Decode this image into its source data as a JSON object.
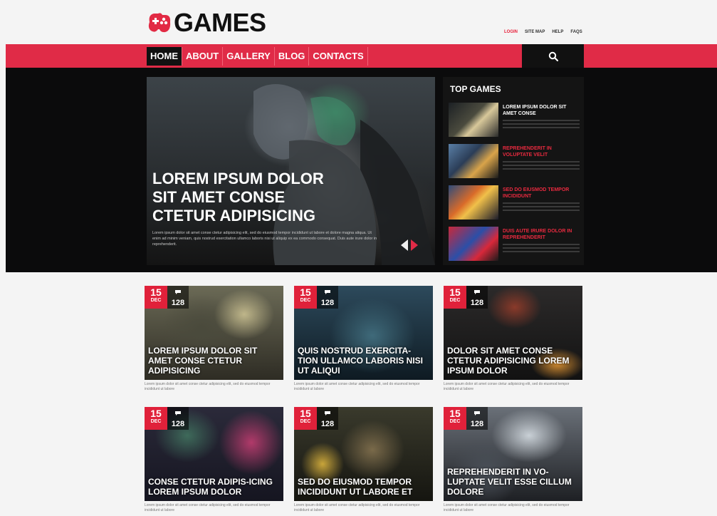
{
  "brand": {
    "name": "GAMES",
    "accent": "#e02b47"
  },
  "top_links": [
    "LOGIN",
    "SITE MAP",
    "HELP",
    "FAQS"
  ],
  "nav": {
    "items": [
      "HOME",
      "ABOUT",
      "GALLERY",
      "BLOG",
      "CONTACTS"
    ],
    "active": "HOME",
    "search_icon": "search-icon"
  },
  "hero": {
    "title": "LOREM IPSUM DOLOR SIT AMET CONSE CTETUR ADIPISICING",
    "text": "Lorem ipsum dolor sit amet conse ctetur adipisicing elit, sed do eiusmod tempor incididunt ut labore et dolore magna aliqua. Ut enim ad minim veniam, quis nostrud exercitation ullamco laboris nisi ut aliquip ex ea commodo consequat. Duis aute irure dolor in reprehenderit."
  },
  "top_games": {
    "heading": "TOP GAMES",
    "items": [
      {
        "title": "LOREM IPSUM DOLOR SIT AMET CONSE",
        "desc": "Lorem ipsum dolor sit amet conse ctetur adipisicing elit"
      },
      {
        "title": "REPREHENDERIT IN VOLUPTATE VELIT",
        "desc": "Lorem ipsum dolor sit amet conse ctetur adipisicing elit"
      },
      {
        "title": "SED DO EIUSMOD TEMPOR INCIDIDUNT",
        "desc": "Lorem ipsum dolor sit amet conse ctetur adipisicing elit"
      },
      {
        "title": "DUIS AUTE IRURE DOLOR IN REPREHENDERIT",
        "desc": "Lorem ipsum dolor sit amet conse ctetur adipisicing elit"
      }
    ]
  },
  "posts": [
    {
      "day": "15",
      "month": "DEC",
      "comments": "128",
      "title": "LOREM IPSUM DOLOR SIT AMET CONSE CTETUR ADIPISICING",
      "text": "Lorem ipsum dolor sit amet conse ctetur adipisicing elit, sed do eiusmod tempor incididunt ut labore"
    },
    {
      "day": "15",
      "month": "DEC",
      "comments": "128",
      "title": "QUIS NOSTRUD EXERCITA-TION ULLAMCO LABORIS NISI UT ALIQUI",
      "text": "Lorem ipsum dolor sit amet conse ctetur adipisicing elit, sed do eiusmod tempor incididunt ut labore"
    },
    {
      "day": "15",
      "month": "DEC",
      "comments": "128",
      "title": "DOLOR SIT AMET CONSE CTETUR ADIPISICING LOREM IPSUM DOLOR",
      "text": "Lorem ipsum dolor sit amet conse ctetur adipisicing elit, sed do eiusmod tempor incididunt ut labore"
    },
    {
      "day": "15",
      "month": "DEC",
      "comments": "128",
      "title": "CONSE CTETUR ADIPIS-ICING LOREM IPSUM DOLOR",
      "text": "Lorem ipsum dolor sit amet conse ctetur adipisicing elit, sed do eiusmod tempor incididunt ut labore"
    },
    {
      "day": "15",
      "month": "DEC",
      "comments": "128",
      "title": "SED DO EIUSMOD TEMPOR INCIDIDUNT UT LABORE ET",
      "text": "Lorem ipsum dolor sit amet conse ctetur adipisicing elit, sed do eiusmod tempor incididunt ut labore"
    },
    {
      "day": "15",
      "month": "DEC",
      "comments": "128",
      "title": "REPREHENDERIT IN VO-LUPTATE VELIT ESSE CILLUM DOLORE",
      "text": "Lorem ipsum dolor sit amet conse ctetur adipisicing elit, sed do eiusmod tempor incididunt ut labore"
    }
  ]
}
